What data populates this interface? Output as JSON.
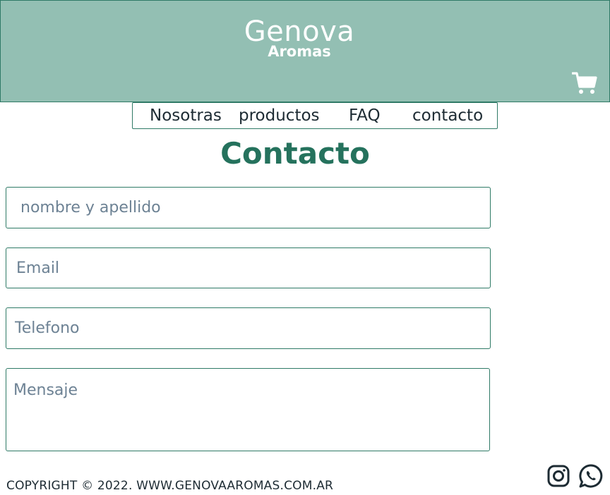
{
  "header": {
    "brand_name": "Genova",
    "brand_sub": "Aromas",
    "cart_icon": "shopping-cart-icon"
  },
  "nav": {
    "items": [
      {
        "label": "Nosotras"
      },
      {
        "label": "productos"
      },
      {
        "label": "FAQ"
      },
      {
        "label": "contacto"
      }
    ]
  },
  "main": {
    "title": "Contacto",
    "form": {
      "name_placeholder": "nombre y apellido",
      "email_placeholder": "Email",
      "phone_placeholder": "Telefono",
      "message_placeholder": "Mensaje"
    }
  },
  "footer": {
    "copyright": "COPYRIGHT © 2022. WWW.GENOVAAROMAS.COM.AR",
    "social": [
      "instagram-icon",
      "whatsapp-icon"
    ]
  },
  "colors": {
    "header_bg": "#93bfb3",
    "accent": "#2f7a66",
    "title": "#25725d"
  }
}
